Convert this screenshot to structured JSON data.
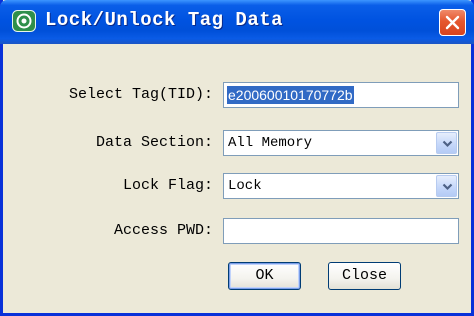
{
  "window": {
    "title": "Lock/Unlock Tag Data",
    "icon": "app-logo-icon",
    "close_icon": "close-icon"
  },
  "form": {
    "select_tag": {
      "label": "Select Tag(TID):",
      "value": "e20060010170772b"
    },
    "data_section": {
      "label": "Data Section:",
      "value": "All Memory"
    },
    "lock_flag": {
      "label": "Lock Flag:",
      "value": "Lock"
    },
    "access_pwd": {
      "label": "Access PWD:",
      "value": ""
    }
  },
  "buttons": {
    "ok": "OK",
    "close": "Close"
  },
  "colors": {
    "titlebar": "#0053e1",
    "frame": "#0831d9",
    "dialog_bg": "#ece9d8",
    "close_button": "#e5572f",
    "selection": "#316ac5",
    "field_border": "#7f9db9"
  }
}
